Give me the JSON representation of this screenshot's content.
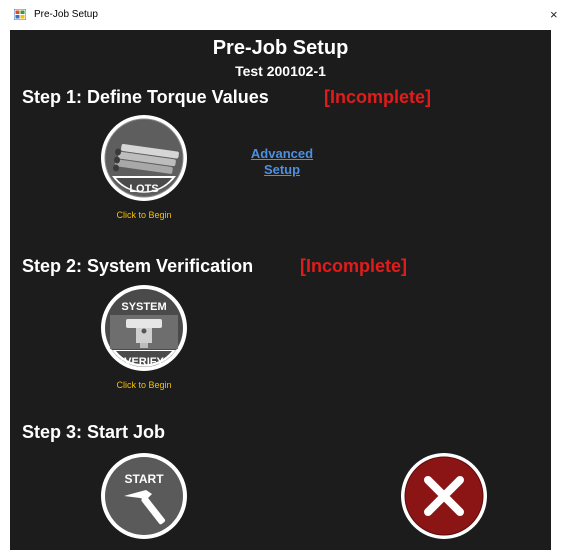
{
  "window": {
    "title": "Pre-Job Setup",
    "close_glyph": "×"
  },
  "header": {
    "title": "Pre-Job Setup",
    "subtitle": "Test 200102-1"
  },
  "steps": [
    {
      "label": "Step 1: Define Torque Values",
      "status": "[Incomplete]",
      "button_text": "LOTS",
      "button_icon": "pipes-icon",
      "hint": "Click to Begin",
      "link_line1": "Advanced",
      "link_line2": "Setup"
    },
    {
      "label": "Step 2: System Verification",
      "status": "[Incomplete]",
      "button_text_top": "SYSTEM",
      "button_text_bottom": "VERIFY",
      "button_icon": "sensor-icon",
      "hint": "Click to Begin"
    },
    {
      "label": "Step 3: Start Job",
      "button_text": "START",
      "button_icon": "hammer-icon",
      "cancel_icon": "cancel-x-icon"
    }
  ],
  "colors": {
    "background": "#1c1c1c",
    "status_red": "#e21b1b",
    "hint_yellow": "#f2c200",
    "link_blue": "#4e8fe0",
    "cancel_red": "#8b1515"
  }
}
